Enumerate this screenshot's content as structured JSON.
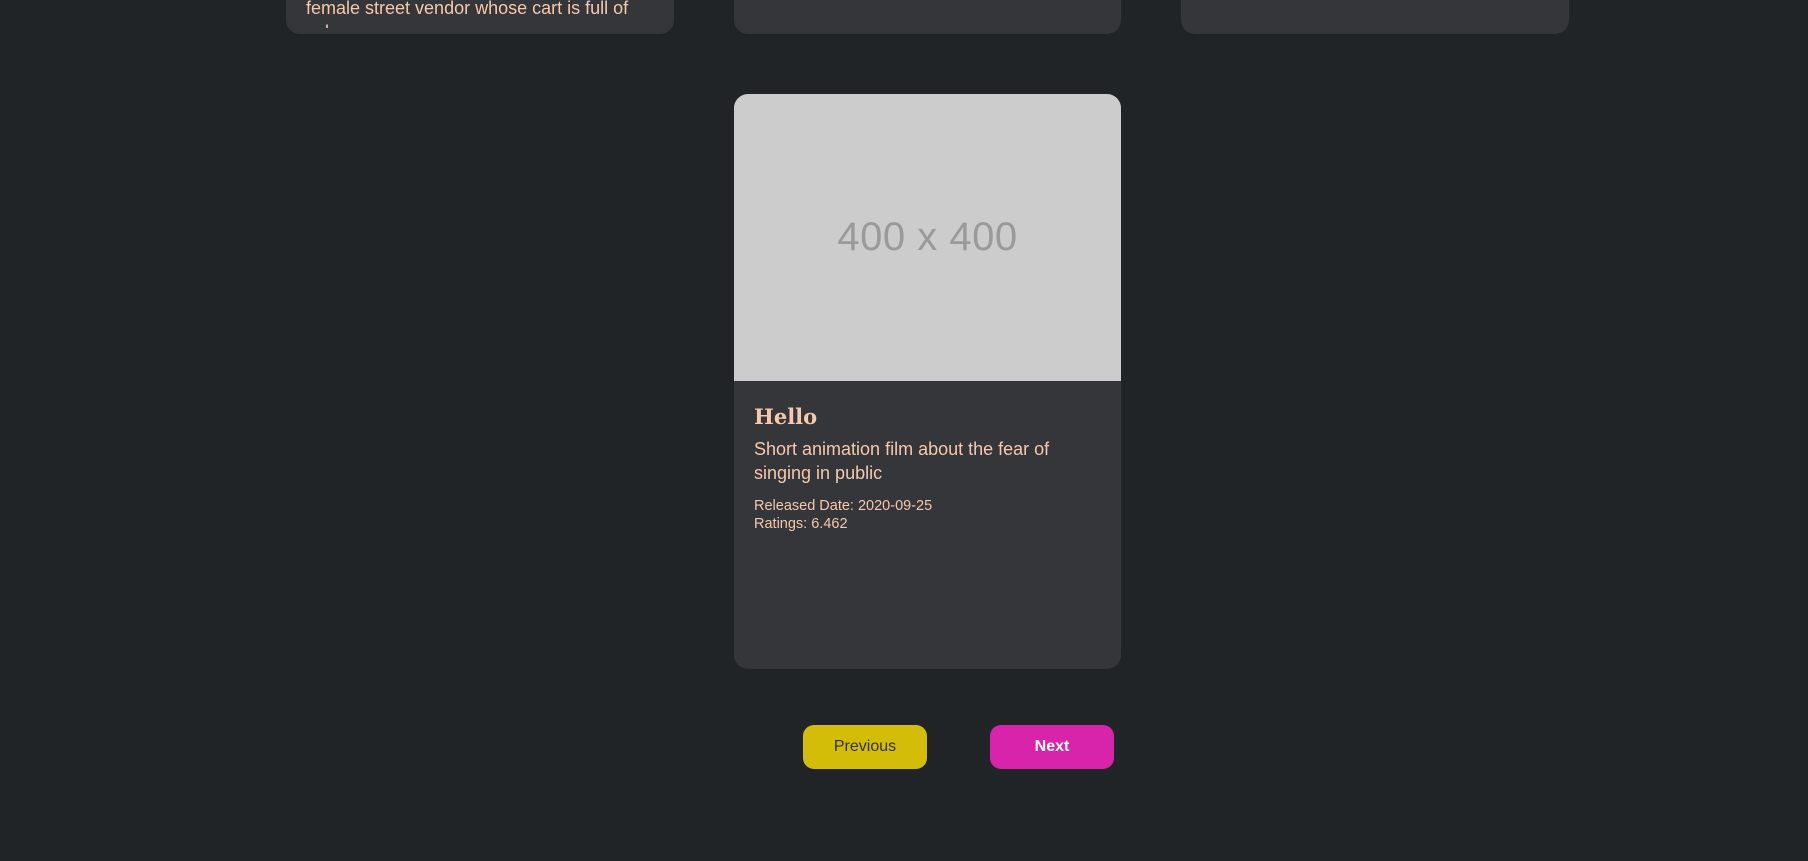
{
  "top_row": {
    "card_1": {
      "description": "female street vendor whose cart is full of colors"
    }
  },
  "featured": {
    "image_placeholder": "400 x 400",
    "title": "Hello",
    "description": "Short animation film about the fear of singing in public",
    "released": "Released Date: 2020-09-25",
    "ratings": "Ratings: 6.462"
  },
  "pagination": {
    "previous_label": "Previous",
    "next_label": "Next"
  },
  "colors": {
    "background": "#212427",
    "card": "#343639",
    "text_accent": "#f6c8ad",
    "previous_button": "#d3bd08",
    "next_button": "#d824aa"
  }
}
